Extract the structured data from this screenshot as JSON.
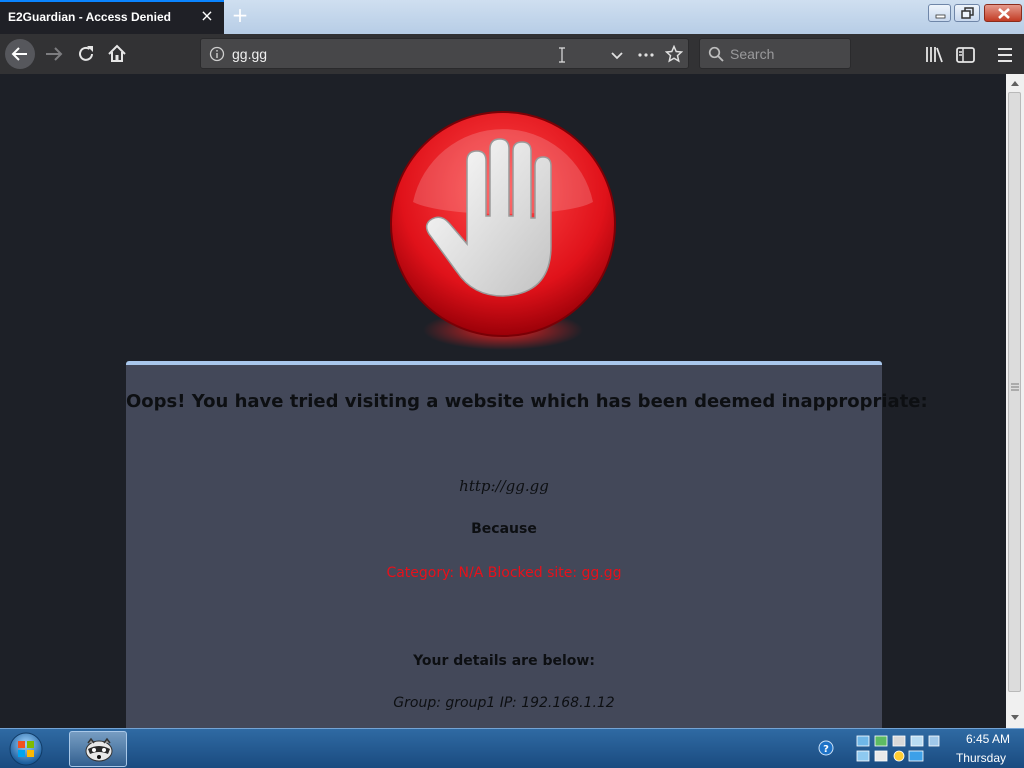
{
  "tab": {
    "title": "E2Guardian - Access Denied",
    "close": "×",
    "new_tab": "+"
  },
  "address": {
    "url": "gg.gg"
  },
  "search": {
    "placeholder": "Search"
  },
  "page": {
    "headline": "Oops! You have tried visiting a website which has been deemed inappropriate:",
    "blocked_url": "http://gg.gg",
    "because": "Because",
    "reason": "Category: N/A   Blocked site: gg.gg",
    "details_heading": "Your details are below:",
    "details": "Group: group1   IP: 192.168.1.12"
  },
  "taskbar": {
    "time": "6:45 AM",
    "day": "Thursday"
  },
  "colors": {
    "accent": "#0a84ff",
    "panel": "#434859",
    "panel_border": "#a9c7ec",
    "reason_text": "#e8101a",
    "stop_sign": "#e0121a"
  },
  "icons": [
    "back-arrow-icon",
    "forward-arrow-icon",
    "reload-icon",
    "home-icon",
    "info-icon",
    "dropdown-chevron-icon",
    "page-actions-icon",
    "bookmark-star-icon",
    "search-icon",
    "library-icon",
    "sidebar-icon",
    "menu-icon",
    "stop-hand-icon",
    "windows-start-icon",
    "raccoon-app-icon",
    "help-icon"
  ]
}
